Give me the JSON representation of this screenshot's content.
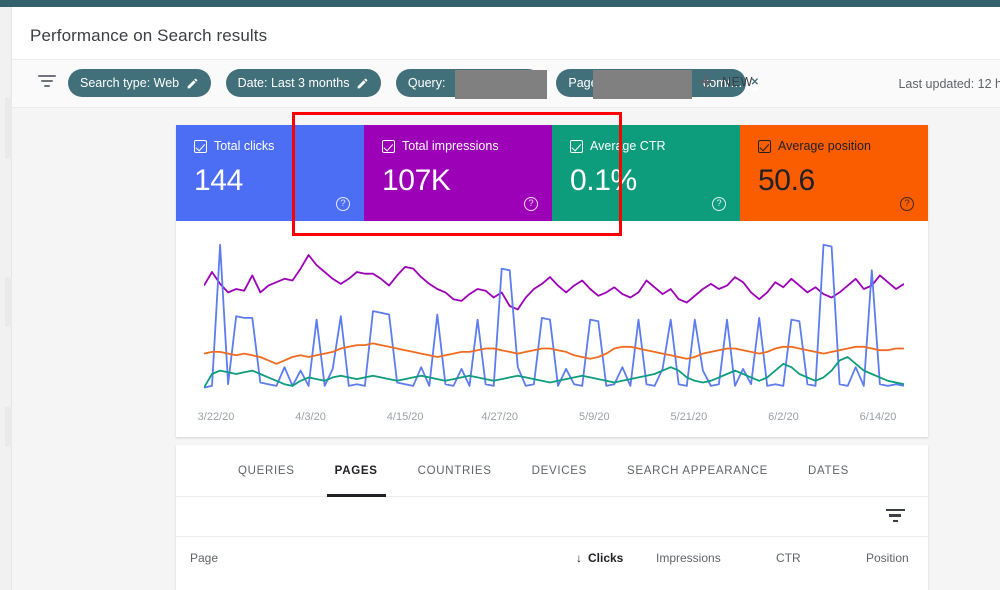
{
  "window": {
    "accent_bar_color": "#34626c"
  },
  "header": {
    "title": "Performance on Search results"
  },
  "toolbar": {
    "filter_icon": "filter-icon",
    "chips": [
      {
        "label": "Search type: Web",
        "edit_icon": "pencil-icon",
        "redacted": false,
        "closable": false
      },
      {
        "label": "Date: Last 3 months",
        "edit_icon": "pencil-icon",
        "redacted": false,
        "closable": false
      },
      {
        "label": "Query:",
        "edit_icon": "",
        "redacted": true,
        "closable": false
      },
      {
        "label": "Page:",
        "suffix": "com/…",
        "edit_icon": "",
        "redacted": true,
        "closable": true,
        "close_icon": "close-icon"
      }
    ],
    "new_button": {
      "label": "NEW",
      "icon": "plus-icon"
    },
    "last_updated": "Last updated: 12 h"
  },
  "metrics": [
    {
      "id": "total-clicks",
      "label": "Total clicks",
      "value": "144",
      "color": "#4c6ef5",
      "text_mode": "light",
      "checked": true,
      "help_icon": "help-icon"
    },
    {
      "id": "total-impressions",
      "label": "Total impressions",
      "value": "107K",
      "color": "#9c00b7",
      "text_mode": "light",
      "checked": true,
      "help_icon": "help-icon"
    },
    {
      "id": "average-ctr",
      "label": "Average CTR",
      "value": "0.1%",
      "color": "#0d9c7c",
      "text_mode": "light",
      "checked": true,
      "help_icon": "help-icon"
    },
    {
      "id": "average-position",
      "label": "Average position",
      "value": "50.6",
      "color": "#fa5c00",
      "text_mode": "dark",
      "checked": true,
      "help_icon": "help-icon"
    }
  ],
  "annotation": {
    "color": "#ff0000",
    "covers": "average-ctr and average-position metric tiles"
  },
  "chart_data": {
    "type": "line",
    "title": "",
    "xlabel": "",
    "ylabel": "",
    "grid": false,
    "legend_position": "none",
    "x_tick_labels": [
      "3/22/20",
      "4/3/20",
      "4/15/20",
      "4/27/20",
      "5/9/20",
      "5/21/20",
      "6/2/20",
      "6/14/20"
    ],
    "series": [
      {
        "name": "Total impressions",
        "color": "#9c00b7",
        "values": [
          62,
          70,
          63,
          58,
          60,
          59,
          68,
          58,
          62,
          64,
          66,
          65,
          72,
          80,
          74,
          70,
          66,
          63,
          66,
          70,
          69,
          69,
          66,
          62,
          68,
          73,
          72,
          67,
          63,
          60,
          58,
          54,
          53,
          57,
          60,
          59,
          55,
          58,
          50,
          48,
          55,
          60,
          63,
          67,
          62,
          58,
          62,
          65,
          60,
          56,
          58,
          61,
          57,
          55,
          58,
          65,
          61,
          57,
          60,
          54,
          52,
          56,
          60,
          63,
          60,
          62,
          67,
          64,
          58,
          54,
          58,
          64,
          61,
          66,
          62,
          58,
          61,
          57,
          55,
          58,
          62,
          66,
          60,
          62,
          68,
          64,
          60,
          63
        ]
      },
      {
        "name": "Total clicks",
        "color": "#5c7cf0",
        "values": [
          2,
          3,
          86,
          4,
          44,
          43,
          43,
          5,
          4,
          3,
          14,
          3,
          12,
          3,
          42,
          3,
          13,
          44,
          3,
          4,
          3,
          47,
          46,
          45,
          5,
          4,
          3,
          14,
          3,
          45,
          4,
          3,
          13,
          3,
          42,
          4,
          3,
          72,
          71,
          14,
          3,
          4,
          43,
          42,
          3,
          13,
          4,
          3,
          42,
          41,
          3,
          4,
          14,
          3,
          42,
          4,
          3,
          13,
          42,
          4,
          3,
          42,
          12,
          3,
          4,
          42,
          3,
          13,
          4,
          43,
          3,
          4,
          3,
          42,
          41,
          4,
          3,
          86,
          85,
          4,
          3,
          14,
          3,
          71,
          4,
          3,
          4,
          3
        ]
      },
      {
        "name": "Average position",
        "color": "#f06b20",
        "values": [
          22,
          23,
          23,
          22,
          21,
          22,
          21,
          20,
          18,
          16,
          18,
          20,
          21,
          20,
          21,
          22,
          23,
          25,
          26,
          27,
          27,
          28,
          27,
          26,
          25,
          24,
          23,
          22,
          21,
          20,
          21,
          22,
          23,
          23,
          24,
          25,
          25,
          24,
          23,
          22,
          23,
          24,
          25,
          25,
          24,
          23,
          21,
          20,
          19,
          20,
          22,
          25,
          26,
          26,
          25,
          24,
          23,
          22,
          21,
          20,
          19,
          20,
          22,
          23,
          24,
          25,
          25,
          24,
          23,
          22,
          23,
          25,
          26,
          26,
          25,
          24,
          23,
          22,
          23,
          24,
          25,
          26,
          26,
          25,
          24,
          24,
          25,
          25
        ]
      },
      {
        "name": "Average CTR",
        "color": "#0d9c7c",
        "values": [
          2,
          10,
          12,
          11,
          10,
          11,
          12,
          10,
          8,
          6,
          4,
          3,
          6,
          8,
          7,
          6,
          8,
          9,
          8,
          7,
          8,
          9,
          8,
          7,
          6,
          7,
          8,
          9,
          8,
          7,
          6,
          7,
          8,
          9,
          8,
          7,
          6,
          7,
          8,
          9,
          8,
          7,
          6,
          5,
          6,
          7,
          8,
          9,
          8,
          7,
          6,
          5,
          6,
          7,
          8,
          9,
          10,
          12,
          14,
          12,
          8,
          6,
          5,
          6,
          8,
          10,
          12,
          10,
          8,
          6,
          8,
          12,
          16,
          14,
          10,
          8,
          6,
          8,
          12,
          18,
          20,
          16,
          12,
          10,
          8,
          6,
          5,
          4
        ]
      }
    ]
  },
  "table": {
    "tabs": [
      {
        "label": "QUERIES",
        "active": false
      },
      {
        "label": "PAGES",
        "active": true
      },
      {
        "label": "COUNTRIES",
        "active": false
      },
      {
        "label": "DEVICES",
        "active": false
      },
      {
        "label": "SEARCH APPEARANCE",
        "active": false
      },
      {
        "label": "DATES",
        "active": false
      }
    ],
    "filter_icon": "filter-icon",
    "columns": [
      {
        "label": "Page",
        "sorted": false,
        "align": "left"
      },
      {
        "label": "Clicks",
        "sorted": true,
        "align": "right",
        "sort_icon": "arrow-down-icon"
      },
      {
        "label": "Impressions",
        "sorted": false,
        "align": "right"
      },
      {
        "label": "CTR",
        "sorted": false,
        "align": "right"
      },
      {
        "label": "Position",
        "sorted": false,
        "align": "right"
      }
    ]
  }
}
